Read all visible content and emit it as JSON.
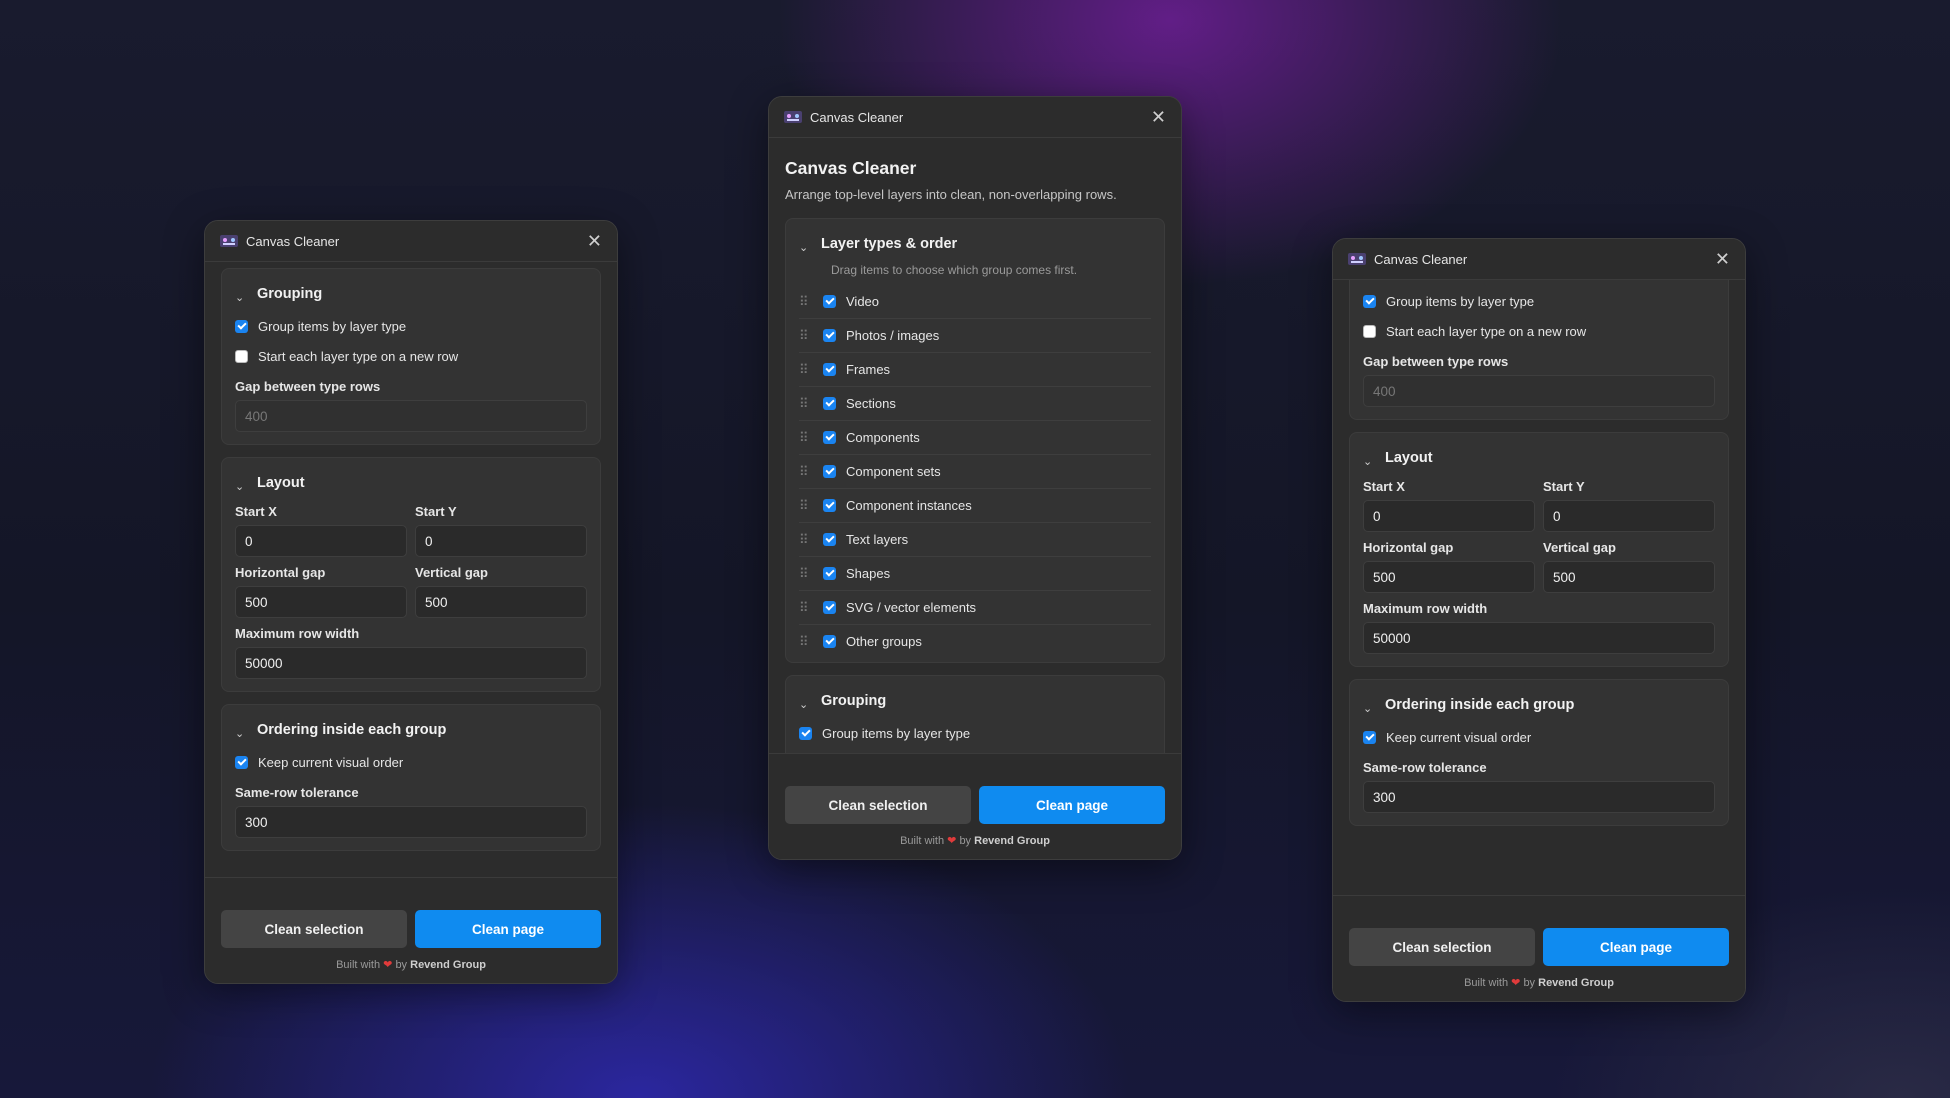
{
  "app": {
    "title": "Canvas Cleaner",
    "heading": "Canvas Cleaner",
    "subtitle": "Arrange top-level layers into clean, non-overlapping rows."
  },
  "sections": {
    "layer_types": "Layer types & order",
    "layer_hint": "Drag items to choose which group comes first.",
    "grouping": "Grouping",
    "layout": "Layout",
    "ordering": "Ordering inside each group"
  },
  "grouping": {
    "group_by_type": "Group items by layer type",
    "new_row_each": "Start each layer type on a new row",
    "gap_label": "Gap between type rows",
    "gap_placeholder": "400"
  },
  "layout": {
    "start_x_label": "Start X",
    "start_x": "0",
    "start_y_label": "Start Y",
    "start_y": "0",
    "hgap_label": "Horizontal gap",
    "hgap": "500",
    "vgap_label": "Vertical gap",
    "vgap": "500",
    "max_width_label": "Maximum row width",
    "max_width": "50000"
  },
  "ordering": {
    "keep_order": "Keep current visual order",
    "tolerance_label": "Same-row tolerance",
    "tolerance": "300"
  },
  "layer_types": [
    {
      "label": "Video"
    },
    {
      "label": "Photos / images"
    },
    {
      "label": "Frames"
    },
    {
      "label": "Sections"
    },
    {
      "label": "Components"
    },
    {
      "label": "Component sets"
    },
    {
      "label": "Component instances"
    },
    {
      "label": "Text layers"
    },
    {
      "label": "Shapes"
    },
    {
      "label": "SVG / vector elements"
    },
    {
      "label": "Other groups"
    }
  ],
  "buttons": {
    "clean_selection": "Clean selection",
    "clean_page": "Clean page"
  },
  "credit": {
    "prefix": "Built with",
    "by": "by",
    "company": "Revend Group"
  },
  "icons": {
    "close": "✕",
    "chevron": "⌄",
    "drag": "⠿",
    "heart": "❤"
  },
  "colors": {
    "accent": "#0f8bf0",
    "checkbox": "#1a84f1",
    "panel": "#2c2c2c"
  }
}
